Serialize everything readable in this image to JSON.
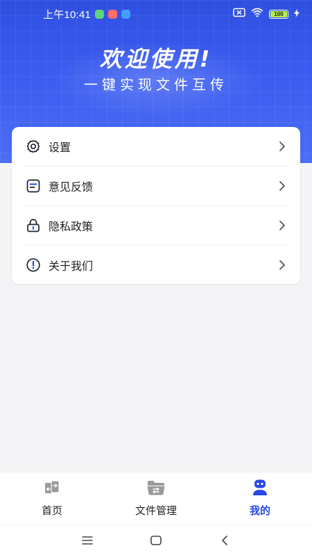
{
  "status_bar": {
    "time": "上午10:41",
    "battery": "100",
    "app_icon_colors": [
      "#5fd37a",
      "#ff6b6b",
      "#3fa0ff"
    ]
  },
  "hero": {
    "title": "欢迎使用!",
    "subtitle": "一键实现文件互传"
  },
  "menu": {
    "items": [
      {
        "label": "设置",
        "icon": "gear-icon"
      },
      {
        "label": "意见反馈",
        "icon": "feedback-icon"
      },
      {
        "label": "隐私政策",
        "icon": "lock-icon"
      },
      {
        "label": "关于我们",
        "icon": "info-icon"
      }
    ]
  },
  "bottom_nav": {
    "tabs": [
      {
        "label": "首页",
        "icon": "transfer-phone-icon",
        "active": false
      },
      {
        "label": "文件管理",
        "icon": "folder-icon",
        "active": false
      },
      {
        "label": "我的",
        "icon": "robot-profile-icon",
        "active": true
      }
    ]
  },
  "system_nav": {
    "buttons": [
      "menu-icon",
      "home-icon",
      "back-icon"
    ]
  },
  "colors": {
    "brand": "#2649e6",
    "hero_top": "#2f4fe0",
    "page_bg": "#f4f4f6"
  }
}
